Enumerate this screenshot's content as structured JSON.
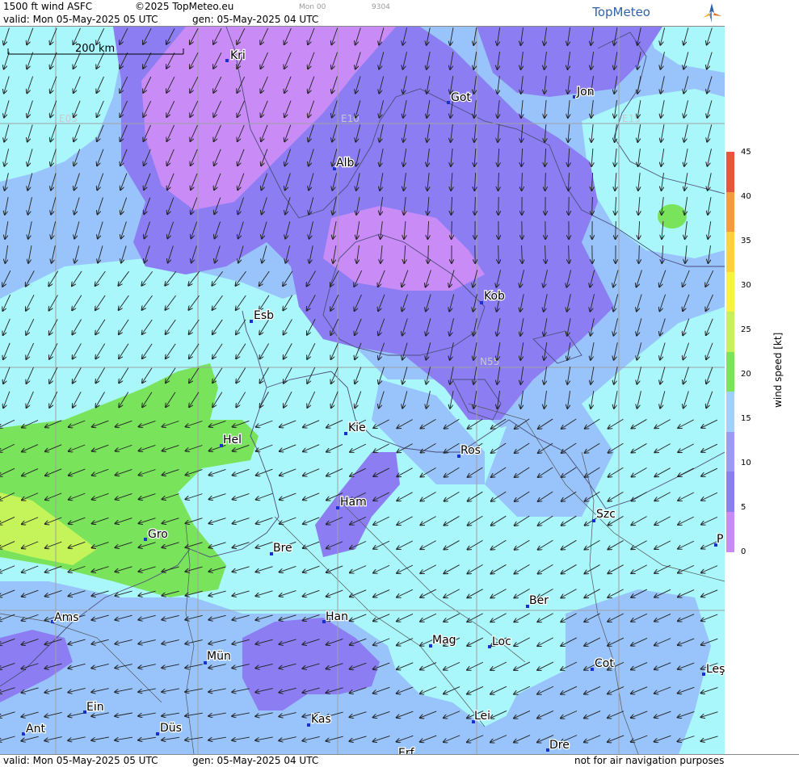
{
  "header": {
    "title": "1500 ft wind ASFC",
    "copyright": "©2025 TopMeteo.eu",
    "valid": "valid:  Mon  05-May-2025  05 UTC",
    "gen": "gen:  05-May-2025 04 UTC",
    "run": "Mon 00",
    "code": "9304",
    "logo": "TopMeteo"
  },
  "footer": {
    "valid": "valid:  Mon  05-May-2025  05 UTC",
    "gen": "gen:  05-May-2025 04 UTC",
    "disclaimer": "not for air navigation purposes"
  },
  "scale": {
    "label": "200 km"
  },
  "grid_labels": [
    "E05",
    "E10",
    "E15",
    "N55"
  ],
  "cities": [
    "Kri",
    "Got",
    "Jon",
    "Alb",
    "Kob",
    "Esb",
    "Kie",
    "Hel",
    "Ros",
    "Ham",
    "Szc",
    "Gro",
    "Bre",
    "P",
    "Ber",
    "Ams",
    "Han",
    "Mag",
    "Loc",
    "Mün",
    "Cot",
    "Leş",
    "Ein",
    "Kas",
    "Lei",
    "Ant",
    "Düs",
    "Dre",
    "Erf"
  ],
  "legend": {
    "label": "wind speed [kt]",
    "ticks": [
      "45",
      "40",
      "35",
      "30",
      "25",
      "20",
      "15",
      "10",
      "5",
      "0"
    ],
    "colors": [
      "#e8553f",
      "#f39b3d",
      "#fdd23a",
      "#f5f53d",
      "#c8f05a",
      "#7fe35a",
      "#a3cffb",
      "#9d99f7",
      "#8a7ff0",
      "#c88af5"
    ]
  },
  "colors": {
    "calm_violet": "#c98cf7",
    "low_purple": "#8c7ef2",
    "mid_blue": "#98c4fb",
    "light_cyan": "#a9f6fb",
    "green": "#79e35c",
    "yellow_green": "#c5f35a"
  }
}
